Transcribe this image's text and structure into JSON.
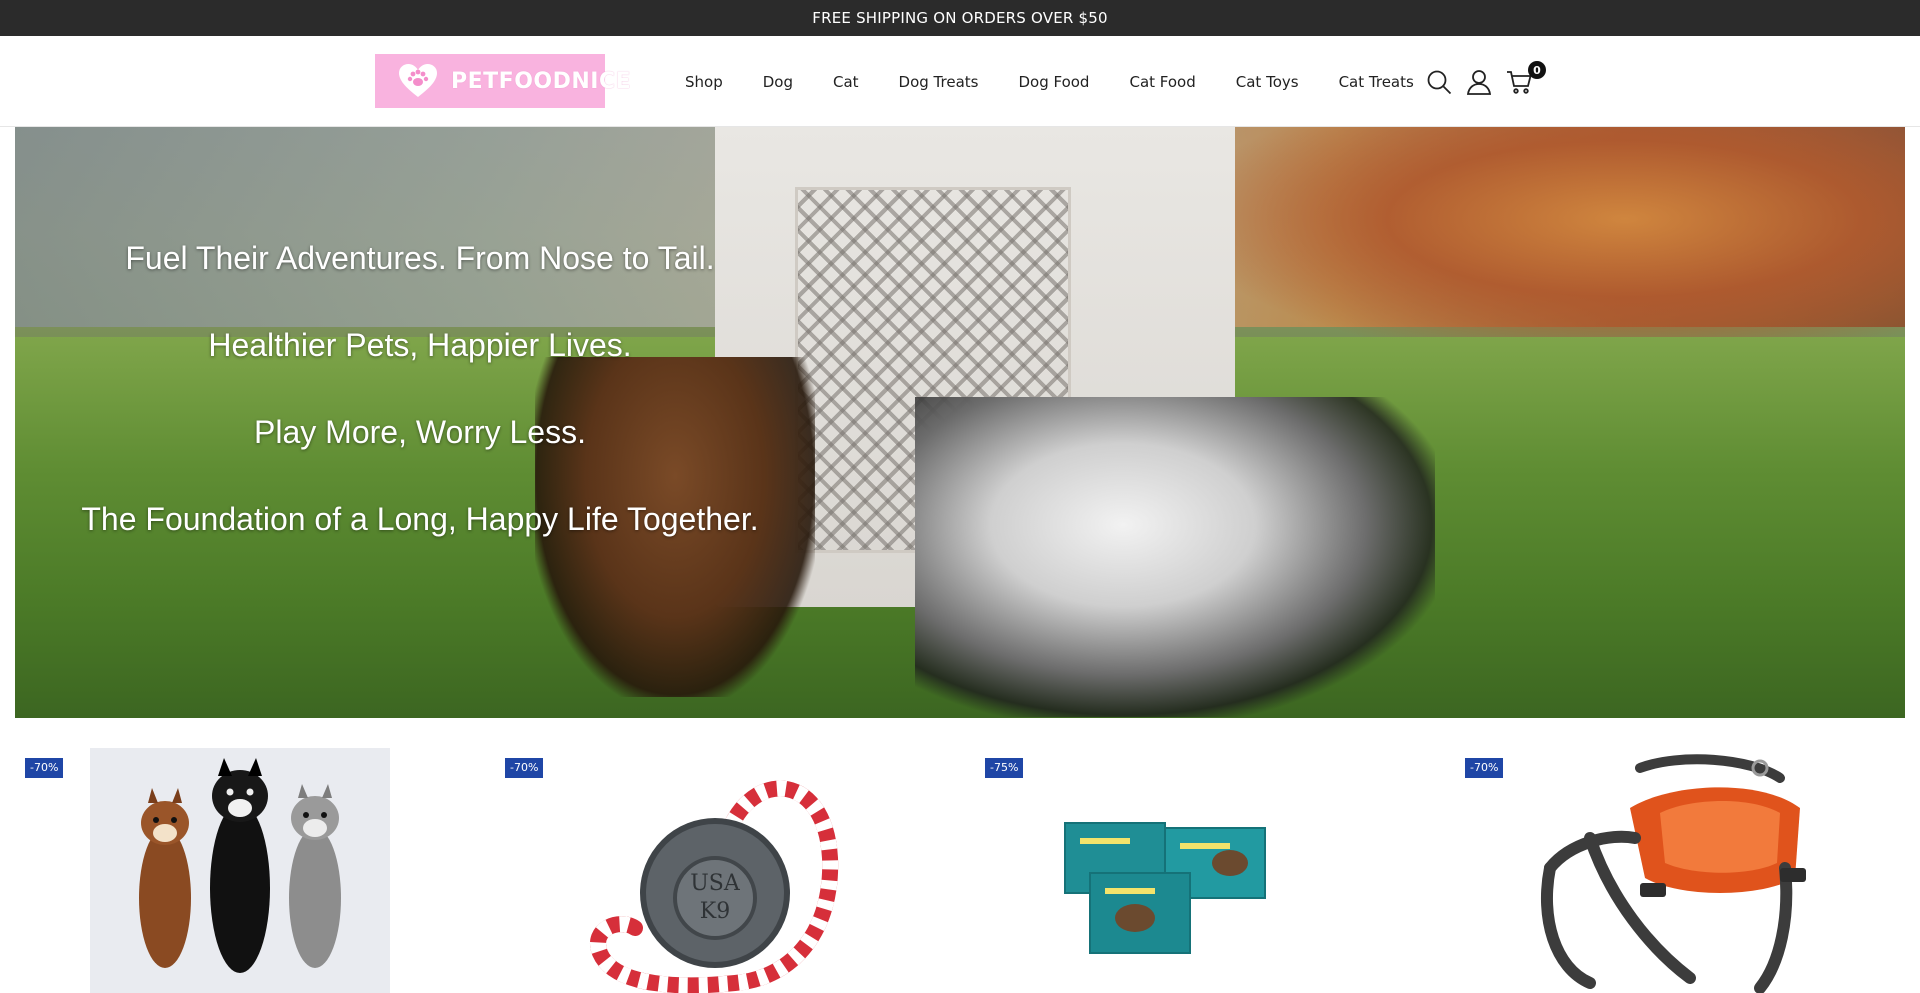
{
  "announcement": {
    "text": "FREE SHIPPING ON ORDERS OVER $50"
  },
  "header": {
    "logo_text": "PETFOODNICE",
    "nav": [
      "Shop",
      "Dog",
      "Cat",
      "Dog Treats",
      "Dog Food",
      "Cat Food",
      "Cat Toys",
      "Cat Treats"
    ],
    "icons": [
      "search-icon",
      "account-icon",
      "cart-icon"
    ],
    "cart_count": "0"
  },
  "hero": {
    "lines": [
      "Fuel Their Adventures. From Nose to Tail.",
      "Healthier Pets, Happier Lives.",
      "Play More, Worry Less.",
      "The Foundation of a Long, Happy Life Together."
    ]
  },
  "products": [
    {
      "badge": "-70%"
    },
    {
      "badge": "-70%"
    },
    {
      "badge": "-75%"
    },
    {
      "badge": "-70%"
    }
  ],
  "colors": {
    "announcement_bg": "#2b2b2b",
    "logo_bg": "#f9b3df",
    "badge_bg": "#1f46a6"
  }
}
